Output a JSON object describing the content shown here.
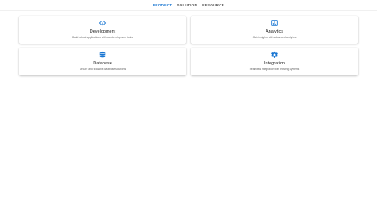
{
  "tabs": [
    {
      "label": "PRODUCT",
      "active": true
    },
    {
      "label": "SOLUTION",
      "active": false
    },
    {
      "label": "RESOURCE",
      "active": false
    }
  ],
  "accent_color": "#1976d2",
  "cards": [
    {
      "title": "Development",
      "description": "Build robust applications with our development tools",
      "icon": "code-icon"
    },
    {
      "title": "Analytics",
      "description": "Gain insights with advanced analytics",
      "icon": "chart-icon"
    },
    {
      "title": "Database",
      "description": "Secure and scalable database solutions",
      "icon": "database-icon"
    },
    {
      "title": "Integration",
      "description": "Seamless integration with existing systems",
      "icon": "settings-icon"
    }
  ]
}
